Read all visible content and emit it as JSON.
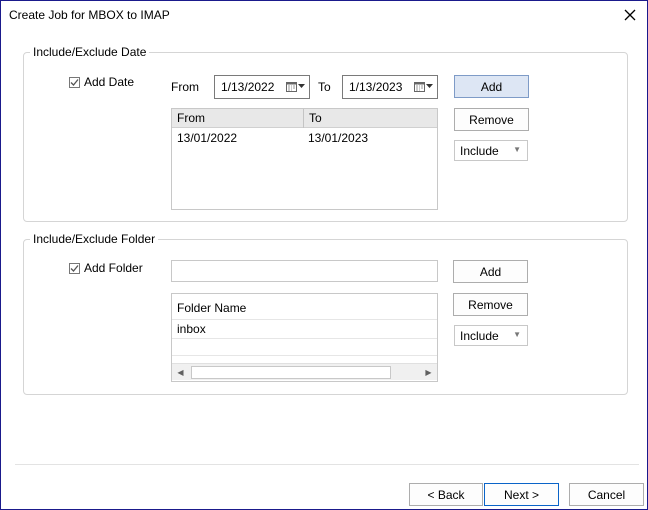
{
  "window": {
    "title": "Create Job for MBOX to IMAP"
  },
  "date_section": {
    "legend": "Include/Exclude Date",
    "add_date_label": "Add Date",
    "add_date_checked": true,
    "from_label": "From",
    "from_value": "1/13/2022",
    "to_label": "To",
    "to_value": "1/13/2023",
    "add_button": "Add",
    "remove_button": "Remove",
    "mode_select": "Include",
    "grid": {
      "columns": [
        "From",
        "To"
      ],
      "rows": [
        {
          "from": "13/01/2022",
          "to": "13/01/2023"
        }
      ]
    }
  },
  "folder_section": {
    "legend": "Include/Exclude Folder",
    "add_folder_label": "Add Folder",
    "add_folder_checked": true,
    "folder_input_value": "",
    "add_button": "Add",
    "remove_button": "Remove",
    "mode_select": "Include",
    "grid": {
      "columns": [
        "Folder Name"
      ],
      "rows": [
        {
          "name": "inbox"
        }
      ]
    }
  },
  "footer": {
    "back_button": "< Back",
    "next_button": "Next >",
    "cancel_button": "Cancel"
  },
  "icons": {
    "close": "close-icon",
    "calendar": "calendar-icon",
    "dropdown": "chevron-down-icon",
    "scroll_left": "scroll-left-icon",
    "scroll_right": "scroll-right-icon"
  },
  "colors": {
    "window_border": "#1a1a8c",
    "primary_button": "#dde6f4",
    "default_button_border": "#0a64c8"
  }
}
